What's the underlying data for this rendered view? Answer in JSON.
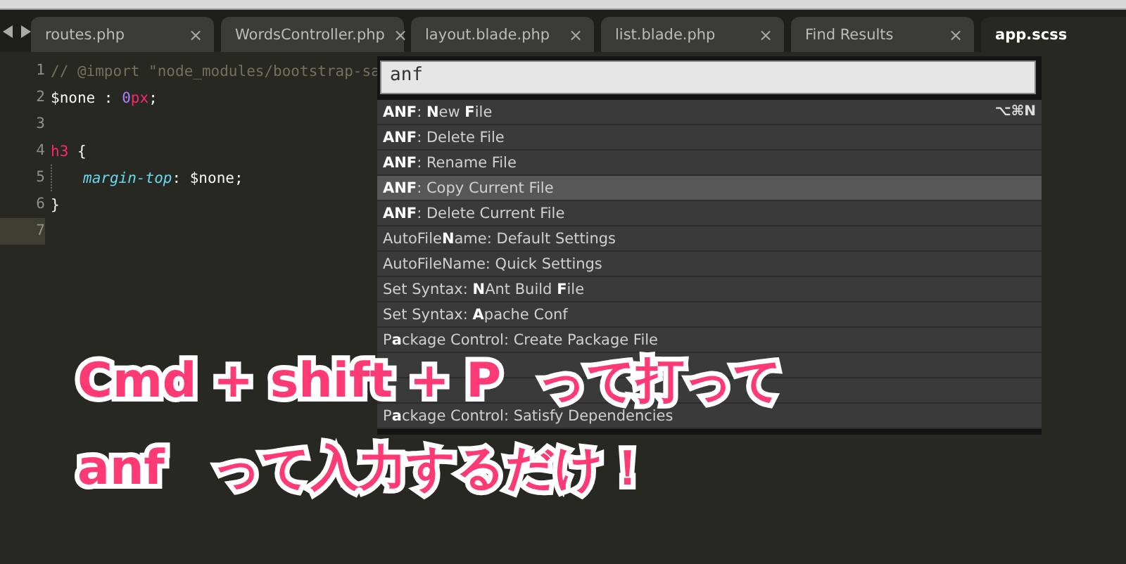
{
  "tabs": [
    {
      "label": "routes.php",
      "selected": false
    },
    {
      "label": "WordsController.php",
      "selected": false
    },
    {
      "label": "layout.blade.php",
      "selected": false
    },
    {
      "label": "list.blade.php",
      "selected": false
    },
    {
      "label": "Find Results",
      "selected": false
    },
    {
      "label": "app.scss",
      "selected": true
    }
  ],
  "close_glyph": "×",
  "editor": {
    "lines": [
      {
        "number": "1",
        "current": false,
        "indent": false,
        "tokens": [
          {
            "kind": "comment",
            "text": "// @import \"node_modules/bootstrap-sa"
          }
        ]
      },
      {
        "number": "2",
        "current": false,
        "indent": false,
        "tokens": [
          {
            "kind": "plain",
            "text": "$none : "
          },
          {
            "kind": "number",
            "text": "0"
          },
          {
            "kind": "keyword",
            "text": "px"
          },
          {
            "kind": "plain",
            "text": ";"
          }
        ]
      },
      {
        "number": "3",
        "current": false,
        "indent": false
      },
      {
        "number": "4",
        "current": false,
        "indent": false,
        "tokens": [
          {
            "kind": "keyword",
            "text": "h3"
          },
          {
            "kind": "plain",
            "text": " {"
          }
        ]
      },
      {
        "number": "5",
        "current": false,
        "indent": true,
        "tokens": [
          {
            "kind": "property",
            "text": "margin-top"
          },
          {
            "kind": "plain",
            "text": ": $none;"
          }
        ]
      },
      {
        "number": "6",
        "current": false,
        "indent": false,
        "tokens": [
          {
            "kind": "plain",
            "text": "}"
          }
        ]
      },
      {
        "number": "7",
        "current": true,
        "indent": false
      }
    ]
  },
  "command_palette": {
    "query": "anf",
    "items": [
      {
        "kind": "command",
        "label": "**ANF**: **N**ew **F**ile",
        "shortcut": "⌥⌘N",
        "selected": false
      },
      {
        "kind": "command",
        "label": "**ANF**: Delete File",
        "selected": false
      },
      {
        "kind": "command",
        "label": "**ANF**: Rename File",
        "selected": false
      },
      {
        "kind": "command",
        "label": "**ANF**: Copy Current File",
        "selected": true
      },
      {
        "kind": "command",
        "label": "**ANF**: Delete Current File",
        "selected": false
      },
      {
        "kind": "command",
        "label": "AutoFile**N**ame: Default Settings",
        "selected": false
      },
      {
        "kind": "command",
        "label": "AutoFileName: Quick Settings",
        "selected": false
      },
      {
        "kind": "command",
        "label": "Set Syntax: **N**Ant Build **F**ile",
        "selected": false
      },
      {
        "kind": "command",
        "label": "Set Syntax: **A**pache Conf",
        "selected": false
      },
      {
        "kind": "command",
        "label": "P**a**ckage Control: Create Package File",
        "selected": false
      },
      {
        "kind": "covered",
        "selected": false
      },
      {
        "kind": "covered",
        "selected": false
      },
      {
        "kind": "command",
        "label": "P**a**ckage Control: Satisfy Dependencies",
        "selected": false
      }
    ]
  },
  "caption": [
    {
      "keys": "Cmd + shift + P",
      "text": "って打って"
    },
    {
      "keys": "anf",
      "text": "って入力するだけ！"
    }
  ]
}
